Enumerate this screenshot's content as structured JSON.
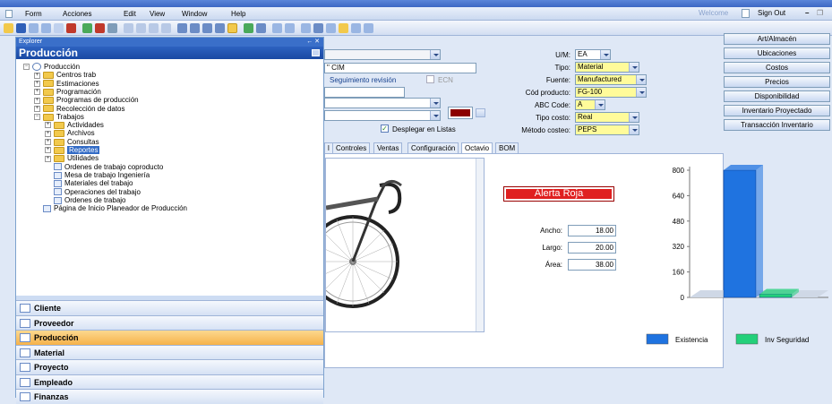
{
  "menu": [
    "Form",
    "Acciones",
    "Edit",
    "View",
    "Window",
    "Help"
  ],
  "menu_right": {
    "welcome": "Welcome",
    "signout": "Sign Out"
  },
  "explorer": {
    "header": "Explorer",
    "header_right": "← ✕",
    "title": "Producción",
    "tree": [
      {
        "label": "Producción",
        "level": 0,
        "type": "root"
      },
      {
        "label": "Centros trab",
        "level": 1,
        "type": "folder"
      },
      {
        "label": "Estimaciones",
        "level": 1,
        "type": "folder"
      },
      {
        "label": "Programación",
        "level": 1,
        "type": "folder"
      },
      {
        "label": "Programas de producción",
        "level": 1,
        "type": "folder"
      },
      {
        "label": "Recolección de datos",
        "level": 1,
        "type": "folder"
      },
      {
        "label": "Trabajos",
        "level": 1,
        "type": "folder"
      },
      {
        "label": "Actividades",
        "level": 2,
        "type": "folder"
      },
      {
        "label": "Archivos",
        "level": 2,
        "type": "folder"
      },
      {
        "label": "Consultas",
        "level": 2,
        "type": "folder"
      },
      {
        "label": "Reportes",
        "level": 2,
        "type": "folder",
        "selected": true
      },
      {
        "label": "Utilidades",
        "level": 2,
        "type": "folder"
      },
      {
        "label": "Ordenes de trabajo coproducto",
        "level": 2,
        "type": "doc"
      },
      {
        "label": "Mesa de trabajo Ingeniería",
        "level": 2,
        "type": "doc"
      },
      {
        "label": "Materiales del trabajo",
        "level": 2,
        "type": "doc"
      },
      {
        "label": "Operaciones del trabajo",
        "level": 2,
        "type": "doc"
      },
      {
        "label": "Ordenes de trabajo",
        "level": 2,
        "type": "doc"
      },
      {
        "label": "Página de Inicio Planeador de Producción",
        "level": 1,
        "type": "doc"
      }
    ],
    "nav": [
      {
        "label": "Cliente"
      },
      {
        "label": "Proveedor"
      },
      {
        "label": "Producción",
        "active": true
      },
      {
        "label": "Material"
      },
      {
        "label": "Proyecto"
      },
      {
        "label": "Empleado"
      },
      {
        "label": "Finanzas"
      }
    ]
  },
  "form": {
    "desc_value": "\" CIM",
    "revision_label": "Seguimiento revisión",
    "ecn_label": "ECN",
    "desplegar_label": "Desplegar en Listas",
    "um_label": "U/M:",
    "um_value": "EA",
    "tipo_label": "Tipo:",
    "tipo_value": "Material",
    "fuente_label": "Fuente:",
    "fuente_value": "Manufactured",
    "codprod_label": "Cód producto:",
    "codprod_value": "FG-100",
    "abc_label": "ABC Code:",
    "abc_value": "A",
    "tipocosto_label": "Tipo costo:",
    "tipocosto_value": "Real",
    "metodo_label": "Método costeo:",
    "metodo_value": "PEPS",
    "swatch_color": "#8b0000"
  },
  "tabs": [
    "l",
    "Controles",
    "Ventas",
    "Configuración",
    "Octavio",
    "BOM"
  ],
  "active_tab": "Octavio",
  "octavio": {
    "alert": "Alerta Roja",
    "ancho_label": "Ancho:",
    "ancho_value": "18.00",
    "largo_label": "Largo:",
    "largo_value": "20.00",
    "area_label": "Área:",
    "area_value": "38.00"
  },
  "right_buttons": [
    "Art/Almacén",
    "Ubicaciones",
    "Costos",
    "Precios",
    "Disponibilidad",
    "Inventario Proyectado",
    "Transacción Inventario"
  ],
  "chart_data": {
    "type": "bar",
    "categories": [
      ""
    ],
    "series": [
      {
        "name": "Existencia",
        "values": [
          800
        ],
        "color": "#1f73e0"
      },
      {
        "name": "Inv Seguridad",
        "values": [
          20
        ],
        "color": "#23d07a"
      }
    ],
    "yticks": [
      0,
      160,
      320,
      480,
      640,
      800
    ],
    "ylim": [
      0,
      800
    ],
    "legend": "bottom"
  }
}
